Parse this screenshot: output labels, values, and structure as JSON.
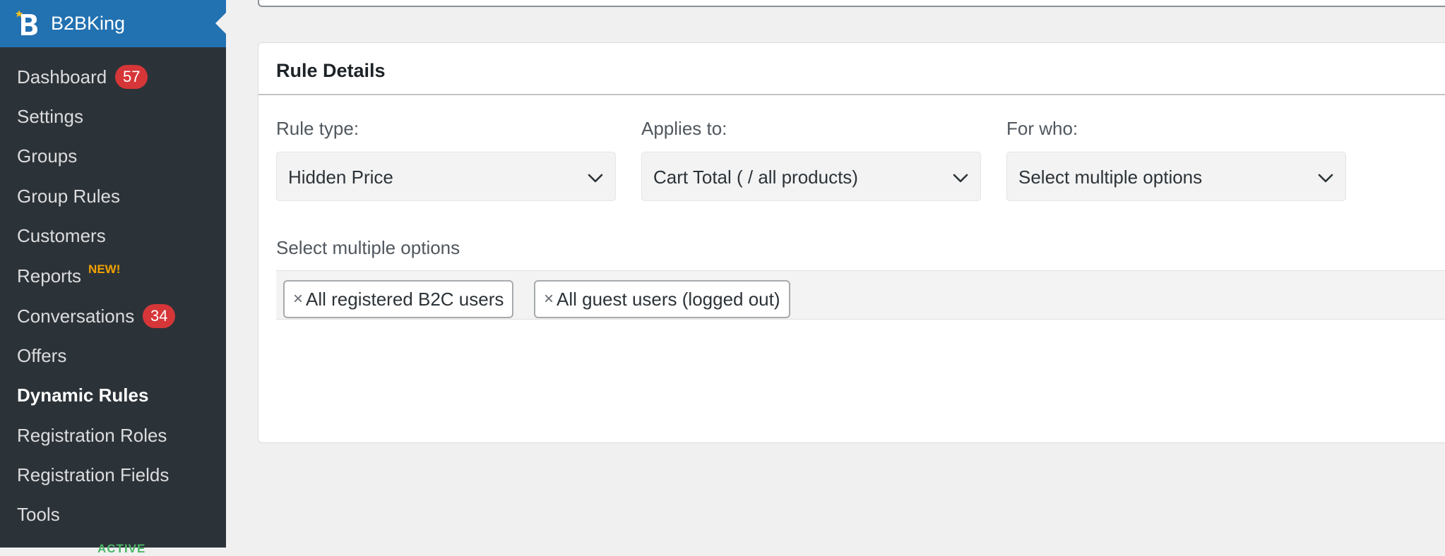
{
  "brand": {
    "name": "B2BKing"
  },
  "sidebar": {
    "items": [
      {
        "label": "Dashboard",
        "badge": "57"
      },
      {
        "label": "Settings"
      },
      {
        "label": "Groups"
      },
      {
        "label": "Group Rules"
      },
      {
        "label": "Customers"
      },
      {
        "label": "Reports",
        "tag": "NEW!"
      },
      {
        "label": "Conversations",
        "badge": "34"
      },
      {
        "label": "Offers"
      },
      {
        "label": "Dynamic Rules",
        "active": true
      },
      {
        "label": "Registration Roles"
      },
      {
        "label": "Registration Fields"
      },
      {
        "label": "Tools"
      }
    ],
    "bottom_peek": "ACTIVE"
  },
  "panel": {
    "title": "Rule Details",
    "rule_type": {
      "label": "Rule type:",
      "value": "Hidden Price"
    },
    "applies_to": {
      "label": "Applies to:",
      "value": "Cart Total ( / all products)"
    },
    "for_who": {
      "label": "For who:",
      "value": "Select multiple options"
    },
    "multi": {
      "label": "Select multiple options",
      "remove_symbol": "×",
      "chips": [
        "All registered B2C users",
        "All guest users (logged out)"
      ]
    }
  },
  "colors": {
    "sidebar_bg": "#2c3338",
    "brand_bg": "#2271b1",
    "badge_bg": "#d63638",
    "new_tag": "#f0a000"
  },
  "icons": {
    "brand_logo": "b2bking-logo-icon",
    "dropdown": "chevron-down-icon",
    "remove": "remove-icon"
  }
}
